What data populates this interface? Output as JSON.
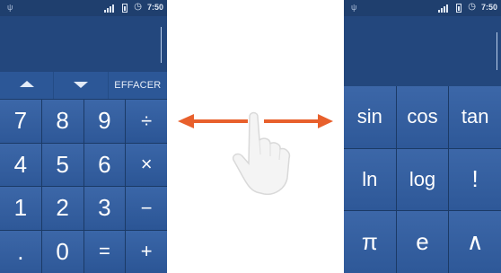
{
  "status_bar": {
    "time": "7:50",
    "usb_icon": "usb-icon",
    "signal_icon": "signal-icon",
    "battery_icon": "battery-icon",
    "alarm_icon": "alarm-icon"
  },
  "basic_panel": {
    "nav": {
      "up_icon": "arrow-up-icon",
      "down_icon": "arrow-down-icon",
      "clear_label": "EFFACER"
    },
    "keys": [
      "7",
      "8",
      "9",
      "÷",
      "4",
      "5",
      "6",
      "×",
      "1",
      "2",
      "3",
      "−",
      ".",
      "0",
      "=",
      "+"
    ]
  },
  "advanced_panel": {
    "keys": [
      "sin",
      "cos",
      "tan",
      "ln",
      "log",
      "!",
      "π",
      "e",
      "∧"
    ]
  },
  "gesture": {
    "icon": "swipe-hand-icon",
    "arrow_color": "#e8602c"
  },
  "colors": {
    "panel_bg": "#24467a",
    "key_bg": "#3c67a8"
  }
}
